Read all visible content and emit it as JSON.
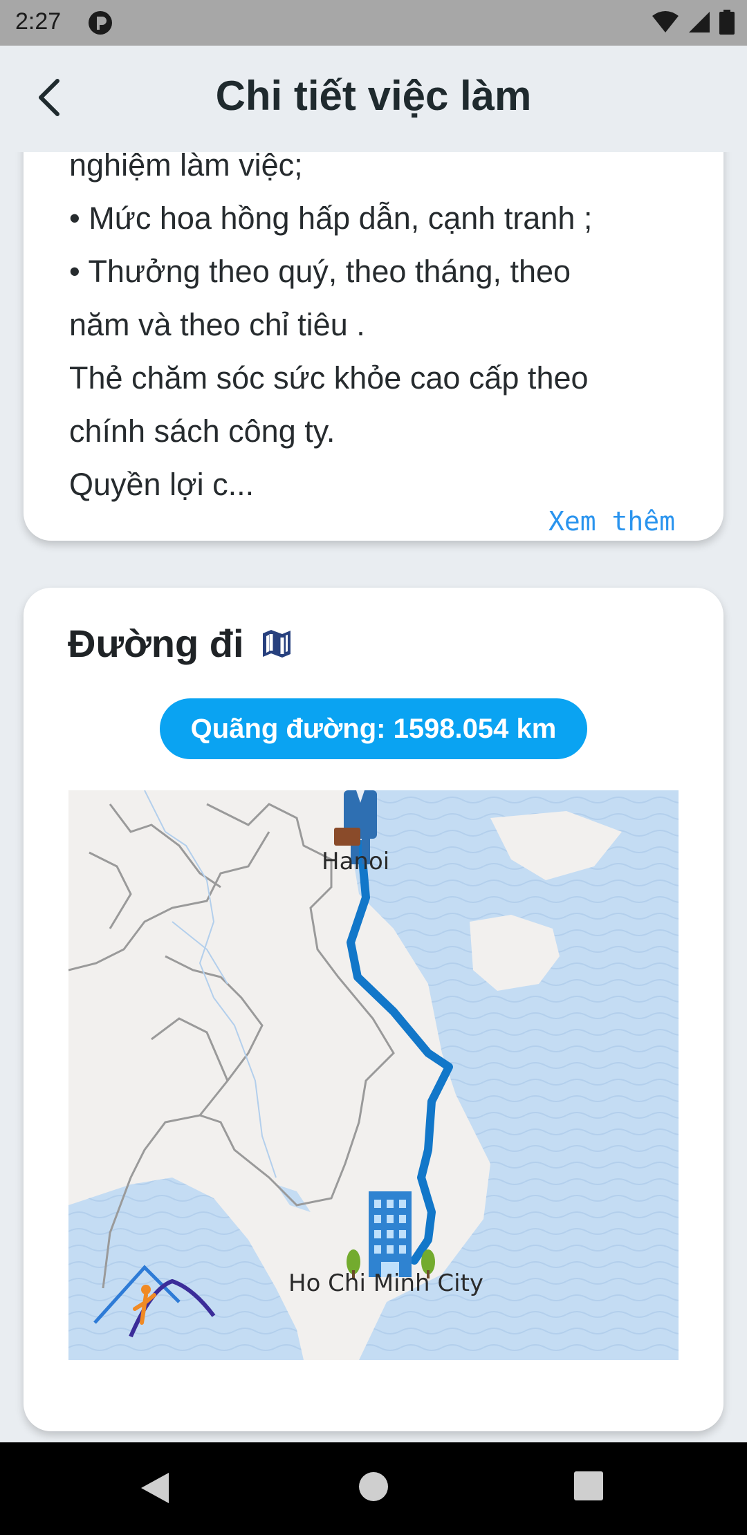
{
  "status_bar": {
    "time": "2:27"
  },
  "app_bar": {
    "title": "Chi tiết việc làm"
  },
  "description": {
    "lines": [
      "nghiệm làm việc;",
      "• Mức  hoa hồng hấp dẫn, cạnh tranh ;",
      "• Thưởng  theo quý, theo tháng, theo",
      "năm và theo chỉ tiêu .",
      " Thẻ chăm sóc sức khỏe cao cấp theo",
      "chính sách công ty.",
      " Quyền lợi c..."
    ],
    "more_label": "Xem thêm"
  },
  "route": {
    "title": "Đường đi",
    "distance_label": "Quãng đường: 1598.054 km",
    "map": {
      "origin_label": "Hanoi",
      "destination_label": "Ho Chi Minh City",
      "route_color": "#1277c9",
      "sea_color": "#c4dcf3"
    }
  },
  "colors": {
    "accent": "#0aa3f2",
    "link": "#2a94ee"
  }
}
